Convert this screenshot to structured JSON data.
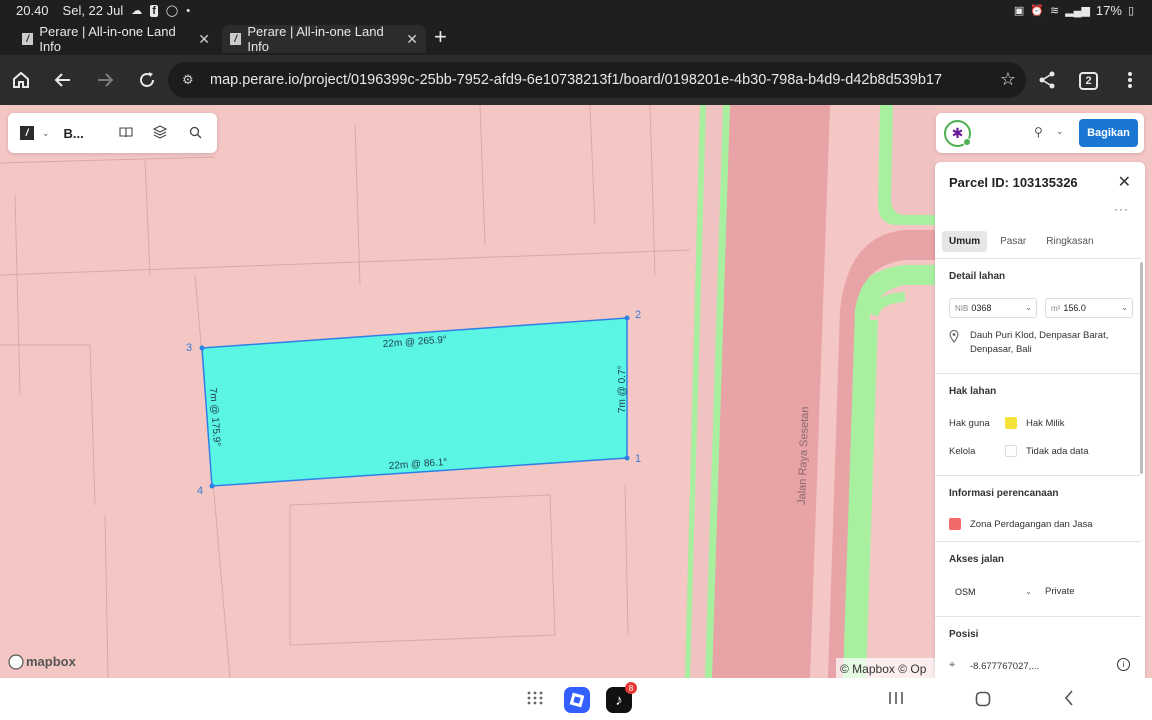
{
  "status_bar": {
    "time": "20.40",
    "date": "Sel, 22 Jul",
    "battery": "17%",
    "icons": [
      "cloud-icon",
      "facebook-icon",
      "whatsapp-icon",
      "dot-icon",
      "battery-saver-icon",
      "alarm-icon",
      "wifi-icon",
      "signal-icon",
      "battery-icon"
    ]
  },
  "tabs": [
    {
      "title": "Perare | All-in-one Land Info",
      "active": false
    },
    {
      "title": "Perare | All-in-one Land Info",
      "active": true
    }
  ],
  "address_bar": {
    "url": "map.perare.io/project/0196399c-25bb-7952-afd9-6e10738213f1/board/0198201e-4b30-798a-b4d9-d42b8d539b17",
    "tab_count": "2"
  },
  "toolbar": {
    "board_label": "B..."
  },
  "share": {
    "share_label": "Bagikan"
  },
  "map": {
    "road_label": "Jalan Raya Sesetan",
    "attribution": "© Mapbox © Op",
    "mapbox_logo": "mapbox",
    "vertices": [
      "1",
      "2",
      "3",
      "4"
    ],
    "edges": [
      {
        "label": "22m @ 265.9°"
      },
      {
        "label": "7m @ 0.7°"
      },
      {
        "label": "22m @ 86.1°"
      },
      {
        "label": "7m @ 175.9°"
      }
    ],
    "colors": {
      "parcel_fill": "#5af5e3",
      "parcel_stroke": "#2f7fe6",
      "background": "#f4c7c5",
      "road": "#e8a3a6",
      "green_strip": "#a8f0a0"
    }
  },
  "panel": {
    "title": "Parcel ID: 103135326",
    "tabs": [
      "Umum",
      "Pasar",
      "Ringkasan"
    ],
    "detail_lahan": {
      "title": "Detail lahan",
      "nib_prefix": "NIB",
      "nib_value": "0368",
      "area_prefix": "m²",
      "area_value": "156.0",
      "location": "Dauh Puri Klod, Denpasar Barat, Denpasar, Bali"
    },
    "hak_lahan": {
      "title": "Hak lahan",
      "rows": [
        {
          "label": "Hak guna",
          "value": "Hak Milik",
          "color": "#f5e23a"
        },
        {
          "label": "Kelola",
          "value": "Tidak ada data",
          "color": "#ffffff"
        }
      ]
    },
    "informasi": {
      "title": "Informasi perencanaan",
      "zone": "Zona Perdagangan dan Jasa",
      "zone_color": "#f06a6a"
    },
    "akses": {
      "title": "Akses jalan",
      "select_value": "OSM",
      "value": "Private"
    },
    "posisi": {
      "title": "Posisi",
      "coordinates": "-8.677767027,..."
    }
  }
}
